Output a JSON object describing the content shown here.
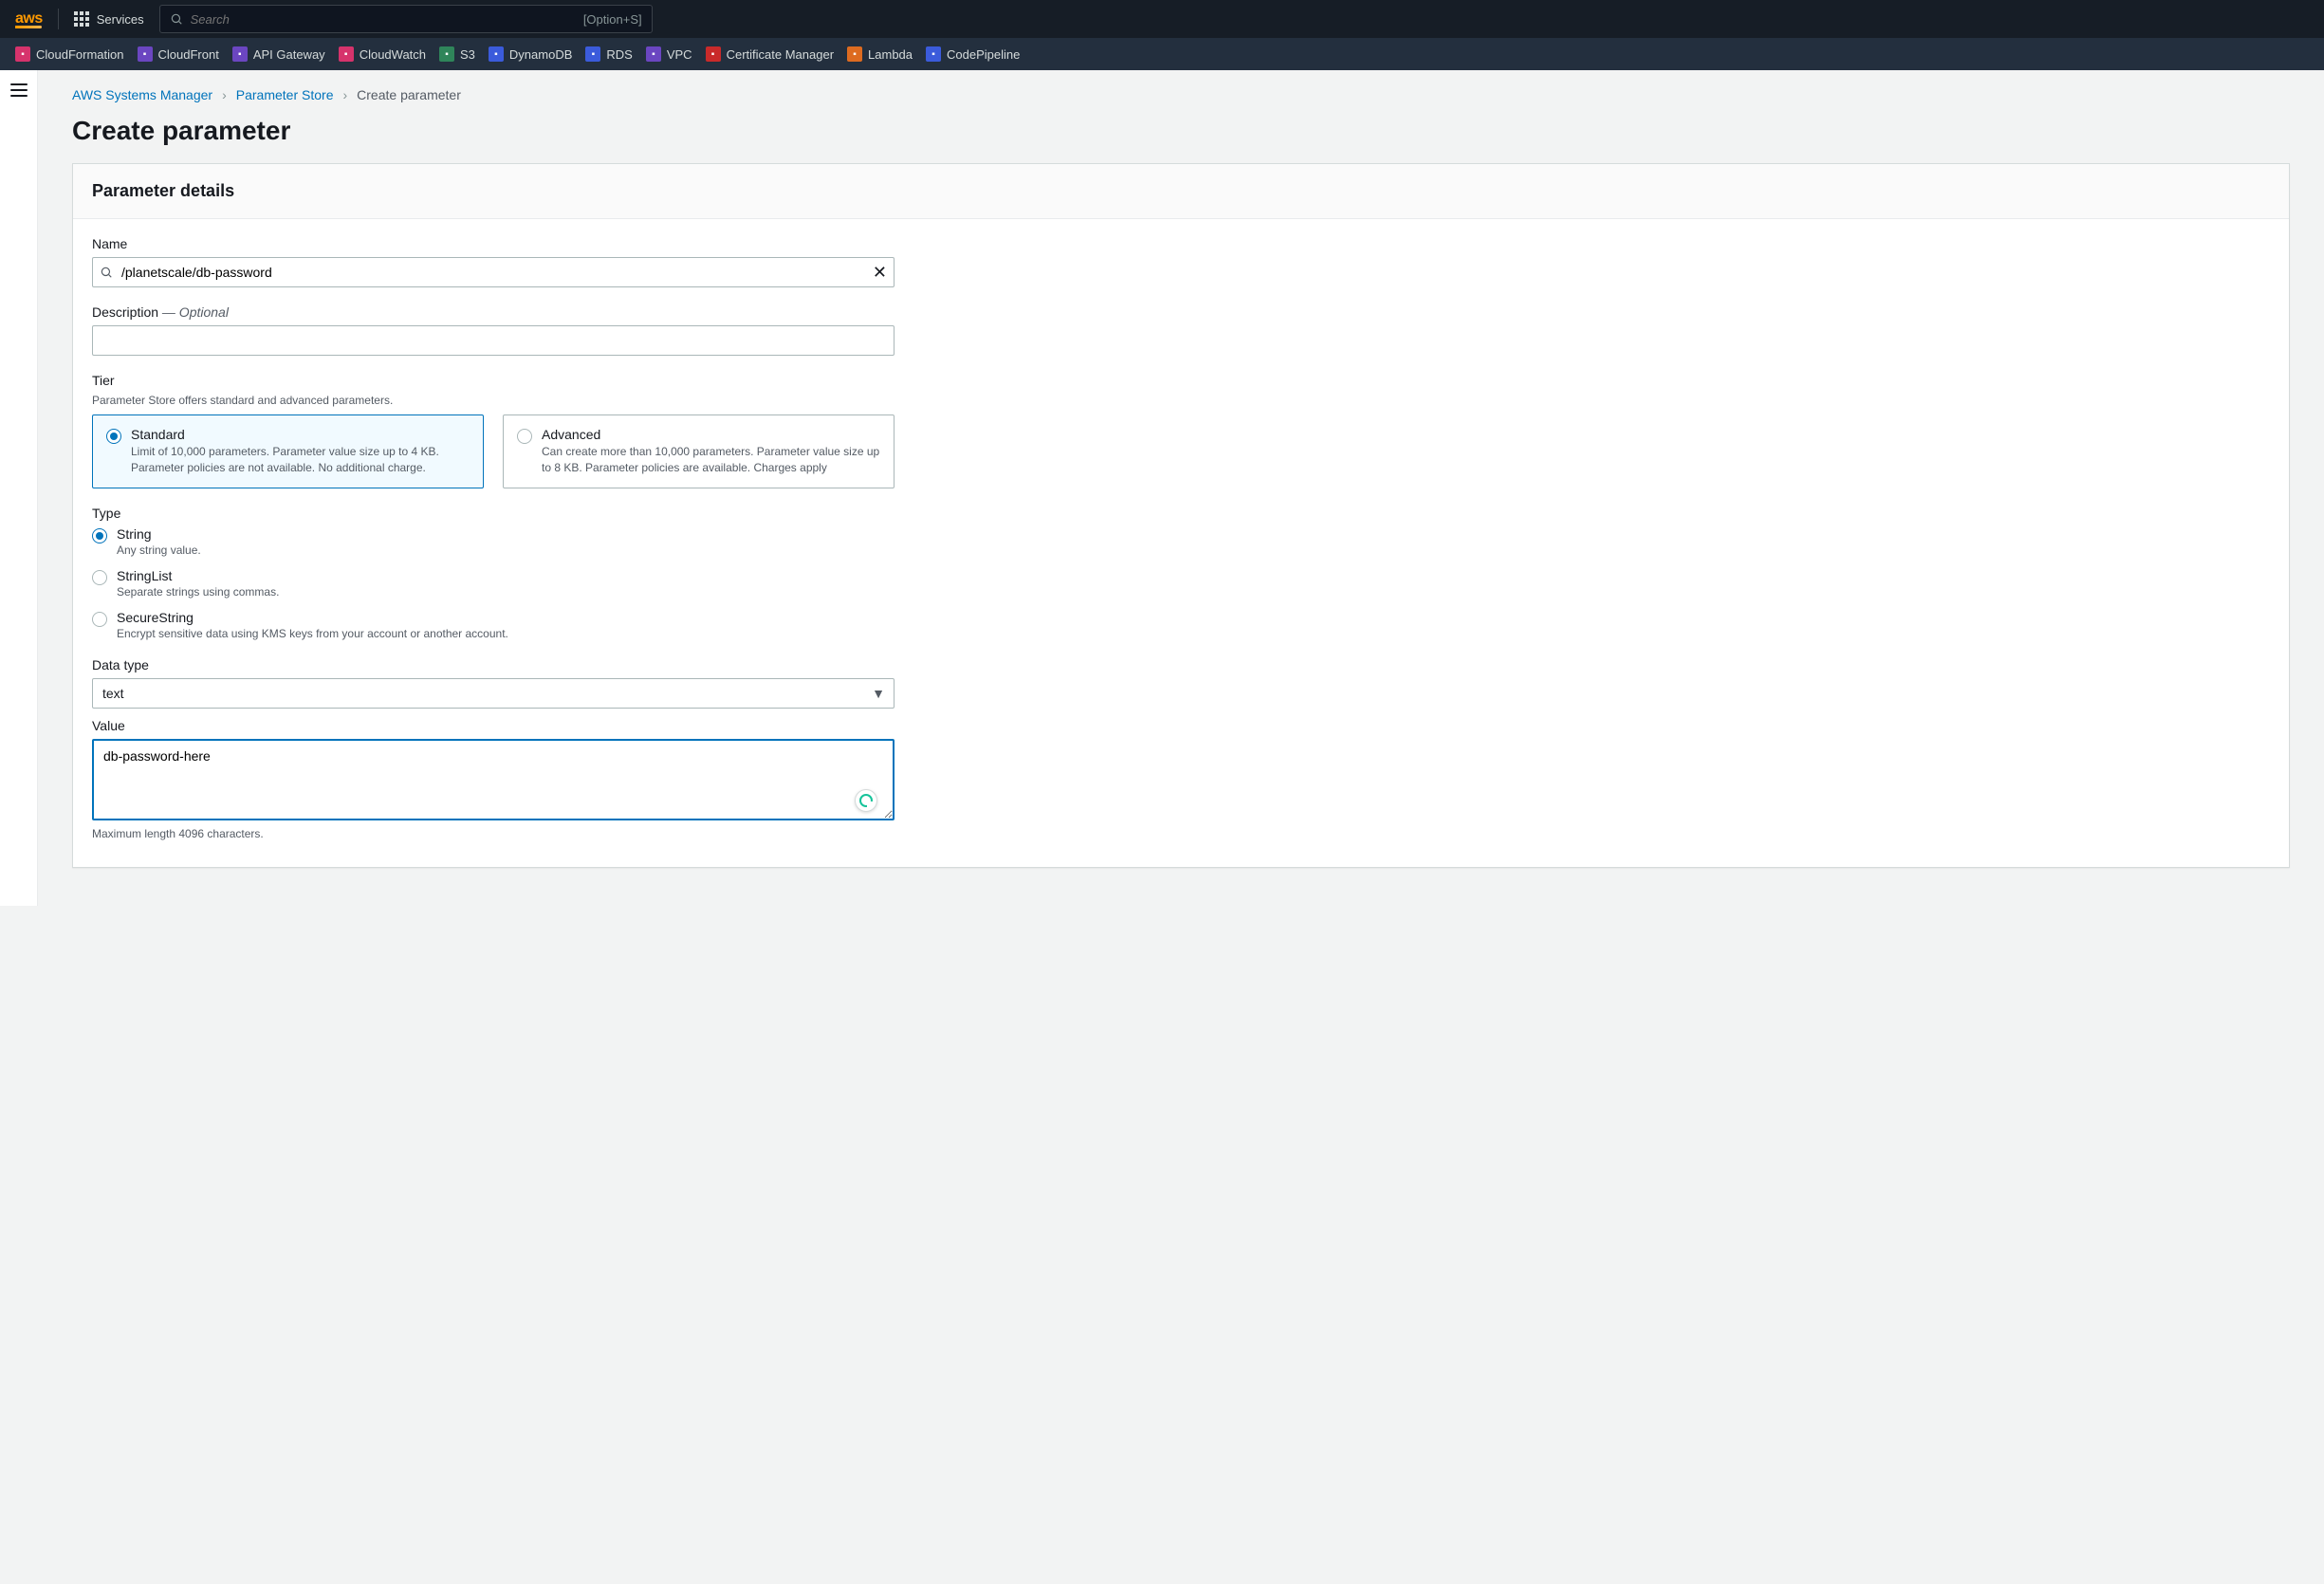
{
  "topnav": {
    "logo": "aws",
    "services_label": "Services",
    "search_placeholder": "Search",
    "search_shortcut": "[Option+S]"
  },
  "servicebar": [
    {
      "label": "CloudFormation",
      "color": "#d6336c"
    },
    {
      "label": "CloudFront",
      "color": "#6b46c1"
    },
    {
      "label": "API Gateway",
      "color": "#6b46c1"
    },
    {
      "label": "CloudWatch",
      "color": "#d6336c"
    },
    {
      "label": "S3",
      "color": "#2f855a"
    },
    {
      "label": "DynamoDB",
      "color": "#3b5bdb"
    },
    {
      "label": "RDS",
      "color": "#3b5bdb"
    },
    {
      "label": "VPC",
      "color": "#6b46c1"
    },
    {
      "label": "Certificate Manager",
      "color": "#c92a2a"
    },
    {
      "label": "Lambda",
      "color": "#dd6b20"
    },
    {
      "label": "CodePipeline",
      "color": "#3b5bdb"
    }
  ],
  "breadcrumb": {
    "root": "AWS Systems Manager",
    "mid": "Parameter Store",
    "current": "Create parameter"
  },
  "page_title": "Create parameter",
  "panel_title": "Parameter details",
  "name": {
    "label": "Name",
    "value": "/planetscale/db-password"
  },
  "description": {
    "label": "Description",
    "optional": " — Optional",
    "value": ""
  },
  "tier": {
    "label": "Tier",
    "hint": "Parameter Store offers standard and advanced parameters.",
    "options": [
      {
        "title": "Standard",
        "desc": "Limit of 10,000 parameters. Parameter value size up to 4 KB. Parameter policies are not available. No additional charge.",
        "selected": true
      },
      {
        "title": "Advanced",
        "desc": "Can create more than 10,000 parameters. Parameter value size up to 8 KB. Parameter policies are available. Charges apply",
        "selected": false
      }
    ]
  },
  "type": {
    "label": "Type",
    "options": [
      {
        "title": "String",
        "desc": "Any string value.",
        "selected": true
      },
      {
        "title": "StringList",
        "desc": "Separate strings using commas.",
        "selected": false
      },
      {
        "title": "SecureString",
        "desc": "Encrypt sensitive data using KMS keys from your account or another account.",
        "selected": false
      }
    ]
  },
  "datatype": {
    "label": "Data type",
    "value": "text"
  },
  "value": {
    "label": "Value",
    "value": "db-password-here",
    "hint": "Maximum length 4096 characters."
  }
}
